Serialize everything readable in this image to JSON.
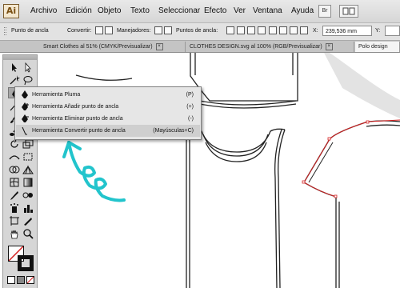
{
  "app": {
    "logo": "Ai"
  },
  "menu": [
    "Archivo",
    "Edición",
    "Objeto",
    "Texto",
    "Seleccionar",
    "Efecto",
    "Ver",
    "Ventana",
    "Ayuda"
  ],
  "menubar_right": {
    "bridge": "Br"
  },
  "options_bar": {
    "tool_name": "Punto de ancla",
    "convert_label": "Convertir:",
    "handles_label": "Manejadores:",
    "anchors_label": "Puntos de ancla:",
    "x_label": "X:",
    "x_value": "239,536 mm",
    "y_label": "Y:"
  },
  "tabs": [
    {
      "label": "Smart Clothes al 51% (CMYK/Previsualizar)",
      "active": false
    },
    {
      "label": "CLOTHES DESIGN.svg al 100% (RGB/Previsualizar)",
      "active": false
    },
    {
      "label": "Polo design",
      "active": true
    }
  ],
  "pen_flyout": [
    {
      "label": "Herramienta Pluma",
      "shortcut": "(P)",
      "icon": "pen-icon"
    },
    {
      "label": "Herramienta Añadir punto de ancla",
      "shortcut": "(+)",
      "icon": "add-anchor-pen-icon"
    },
    {
      "label": "Herramienta Eliminar punto de ancla",
      "shortcut": "(-)",
      "icon": "delete-anchor-pen-icon"
    },
    {
      "label": "Herramienta Convertir punto de ancla",
      "shortcut": "(Mayúsculas+C)",
      "icon": "convert-anchor-icon"
    }
  ],
  "colors": {
    "annotation": "#22c4cc",
    "selection_path": "#d62020"
  }
}
